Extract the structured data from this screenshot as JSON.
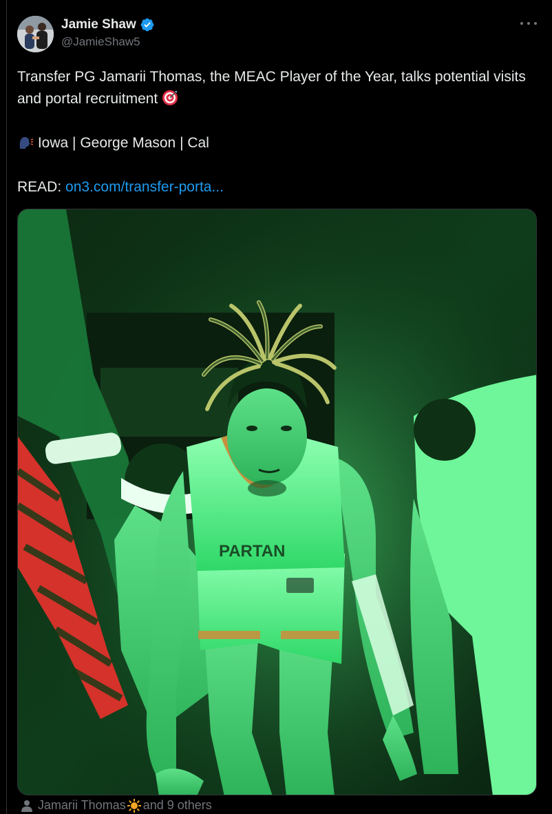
{
  "tweet": {
    "author_name": "Jamie Shaw",
    "author_handle": "@JamieShaw5",
    "verified": true,
    "text_line_1": "Transfer PG Jamarii Thomas, the MEAC Player of the Year, talks potential visits and portal recruitment",
    "text_line_1_emoji": "direct-hit-target-icon",
    "schools_icon": "speaking-head-icon",
    "schools_text": "Iowa | George Mason | Cal",
    "read_label": "READ:",
    "read_link_text": "on3.com/transfer-porta...",
    "media_description_icon": "photo",
    "tagged_name": "Jamarii Thomas",
    "tagged_emoji": "sun-icon",
    "tagged_suffix": "and 9 others"
  },
  "colors": {
    "background": "#000000",
    "text": "#e7e9ea",
    "secondary_text": "#71767b",
    "link": "#1d9bf0",
    "verified_badge": "#1d9bf0",
    "photo_green": "#3fcf6a"
  },
  "icons": {
    "more": "more-horizontal-icon",
    "verified": "verified-badge-icon",
    "person": "person-icon"
  }
}
